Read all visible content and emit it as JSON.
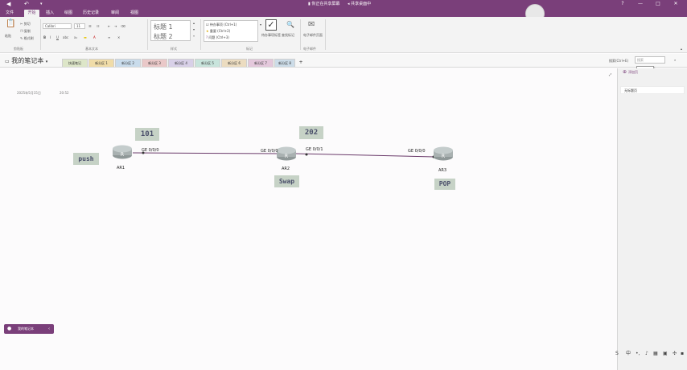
{
  "titlebar": {
    "meeting_text": "你正在共享屏幕",
    "share_text": "共享桌面中",
    "back_icon": "back-arrow-icon",
    "undo_icon": "undo-icon",
    "dropdown_icon": "chevron-down-icon",
    "help": "?",
    "minimize": "—",
    "maximize": "□",
    "close": "✕"
  },
  "menu": {
    "tabs": [
      "文件",
      "开始",
      "插入",
      "绘图",
      "历史记录",
      "审阅",
      "视图"
    ],
    "active": "开始"
  },
  "ribbon": {
    "clipboard": {
      "paste": "粘贴",
      "cut": "剪切",
      "copy": "复制",
      "format_painter": "格式刷",
      "group": "剪贴板"
    },
    "font": {
      "family": "Calibri",
      "size": "11",
      "bold": "B",
      "italic": "I",
      "underline": "U",
      "group": "基本文本"
    },
    "styles": {
      "h1": "标题 1",
      "h2": "标题 2",
      "group": "样式"
    },
    "tags": {
      "items": [
        "待办事项 (Ctrl+1)",
        "重要 (Ctrl+2)",
        "问题 (Ctrl+3)"
      ],
      "todo_tag": "待办事项标签",
      "find_tags": "查找标记",
      "group": "标记"
    },
    "email": {
      "label": "电子邮件页面",
      "group": "电子邮件"
    }
  },
  "notebook": {
    "title": "我的笔记本",
    "sections": [
      "快速笔记",
      "新分区 1",
      "新分区 2",
      "新分区 3",
      "新分区 4",
      "新分区 5",
      "新分区 6",
      "新分区 7",
      "新分区 8"
    ],
    "add_section": "+",
    "search_label": "搜索(Ctrl+E)",
    "search_placeholder": "搜索",
    "tooltip": "开始"
  },
  "page": {
    "date": "2025年5月15日",
    "time": "20:52",
    "labels": {
      "push": "push",
      "l101": "101",
      "l202": "202",
      "swap": "Swap",
      "pop": "POP"
    },
    "routers": [
      "AR1",
      "AR2",
      "AR3"
    ],
    "interfaces": {
      "ar1_g000": "GE 0/0/0",
      "ar2_g000": "GE 0/0/0",
      "ar2_g001": "GE 0/0/1",
      "ar3_g000": "GE 0/0/0"
    },
    "link_color": "#6a3a6a"
  },
  "pagelist": {
    "add_page": "添加页",
    "entries": [
      "无标题页"
    ]
  },
  "bottom_pill": {
    "label": "我的笔记本"
  },
  "tray": {
    "lang": "中"
  },
  "colors": {
    "brand": "#7a3f7a",
    "label_bg": "#c6d2c6",
    "label_text": "#4a4f6a",
    "router": "#a9b1b1"
  }
}
